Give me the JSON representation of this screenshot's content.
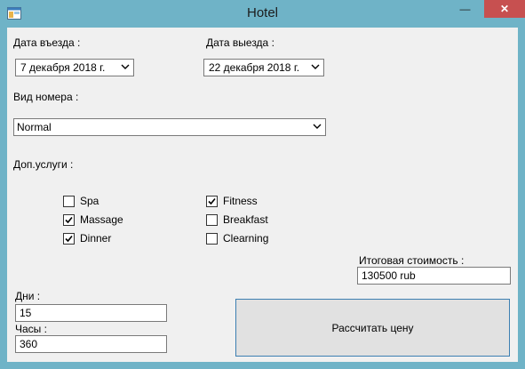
{
  "window": {
    "title": "Hotel",
    "minimize_glyph": "—",
    "maximize_glyph": "☐",
    "close_glyph": "✕"
  },
  "form": {
    "checkin_label": "Дата въезда :",
    "checkin_value": "7 декабря  2018 г.",
    "checkout_label": "Дата выезда :",
    "checkout_value": "22 декабря  2018 г.",
    "room_type_label": "Вид номера :",
    "room_type_value": "Normal",
    "services_label": "Доп.услуги :",
    "services": [
      {
        "label": "Spa",
        "checked": false
      },
      {
        "label": "Massage",
        "checked": true
      },
      {
        "label": "Dinner",
        "checked": true
      },
      {
        "label": "Fitness",
        "checked": true
      },
      {
        "label": "Breakfast",
        "checked": false
      },
      {
        "label": "Clearning",
        "checked": false
      }
    ],
    "total_label": "Итоговая стоимость :",
    "total_value": "130500 rub",
    "days_label": "Дни :",
    "days_value": "15",
    "hours_label": "Часы :",
    "hours_value": "360",
    "calculate_button": "Рассчитать цену"
  },
  "colors": {
    "titlebar": "#6fb3c7",
    "close_button": "#c75050",
    "client_bg": "#f0f0f0",
    "button_border": "#3c7fb1"
  }
}
